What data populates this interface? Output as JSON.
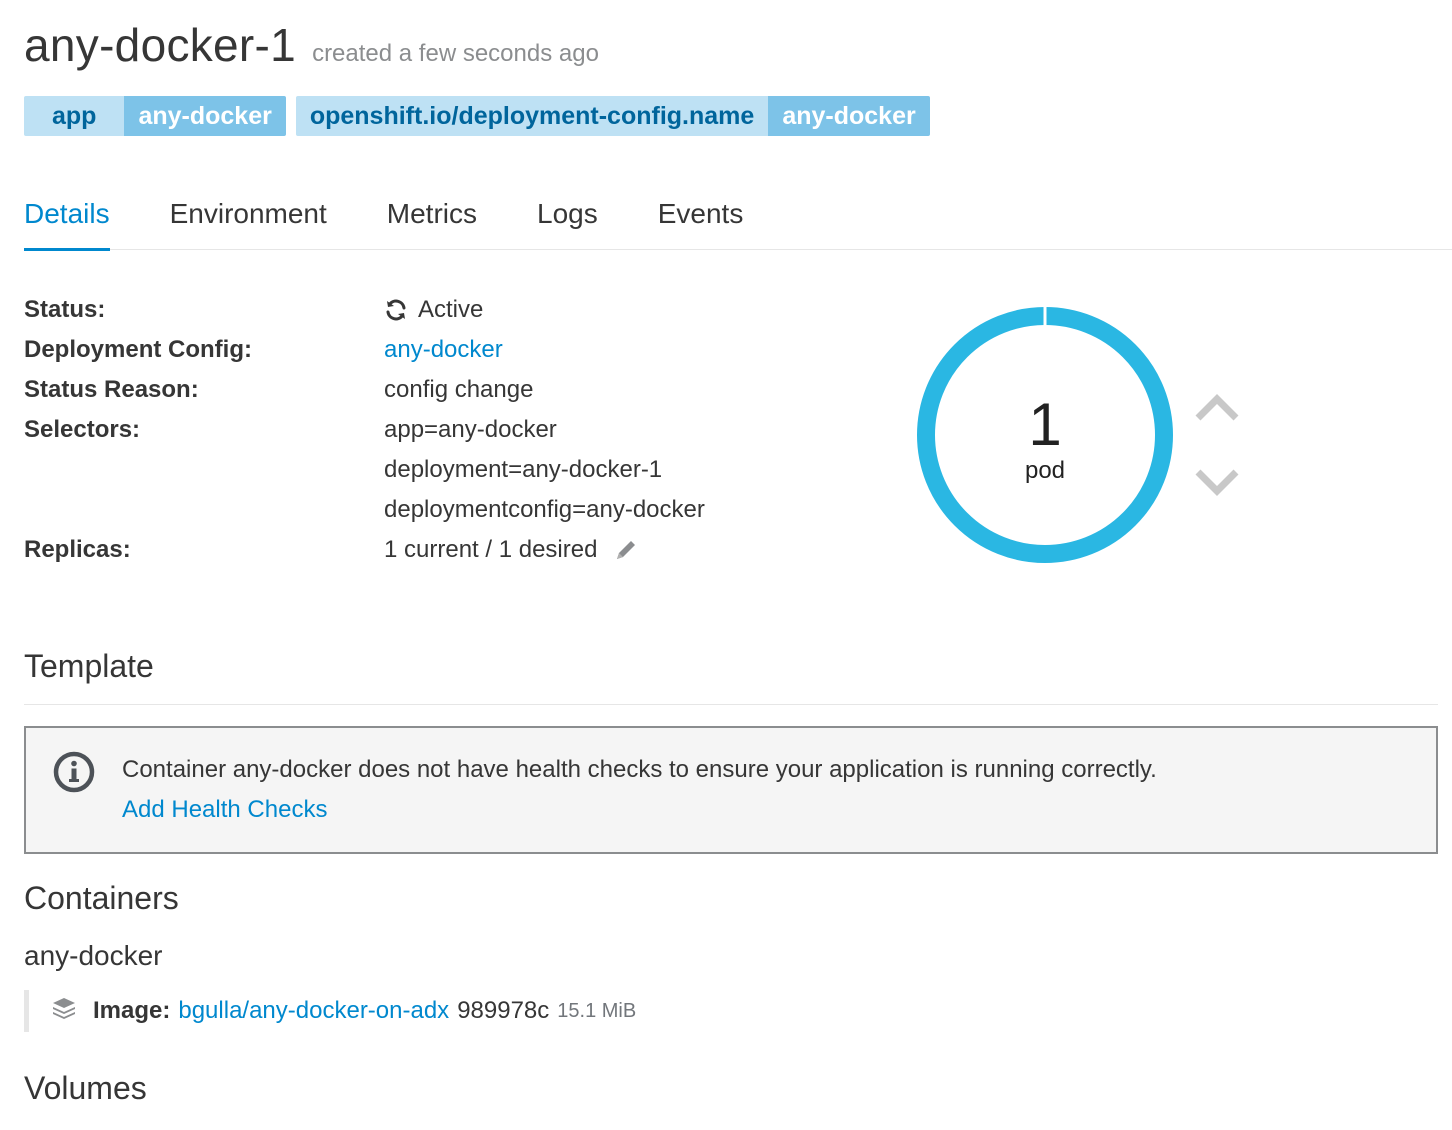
{
  "header": {
    "title": "any-docker-1",
    "created": "created a few seconds ago"
  },
  "labels": [
    {
      "key": "app",
      "value": "any-docker"
    },
    {
      "key": "openshift.io/deployment-config.name",
      "value": "any-docker"
    }
  ],
  "tabs": [
    "Details",
    "Environment",
    "Metrics",
    "Logs",
    "Events"
  ],
  "active_tab": "Details",
  "details": {
    "status_key": "Status:",
    "status_value": "Active",
    "deployment_config_key": "Deployment Config:",
    "deployment_config_value": "any-docker",
    "status_reason_key": "Status Reason:",
    "status_reason_value": "config change",
    "selectors_key": "Selectors:",
    "selectors": [
      "app=any-docker",
      "deployment=any-docker-1",
      "deploymentconfig=any-docker"
    ],
    "replicas_key": "Replicas:",
    "replicas_value": "1 current / 1 desired"
  },
  "donut": {
    "count": "1",
    "unit": "pod",
    "color": "#2ab7e3"
  },
  "template": {
    "title": "Template",
    "alert_text": "Container any-docker does not have health checks to ensure your application is running correctly.",
    "alert_link": "Add Health Checks"
  },
  "containers": {
    "title": "Containers",
    "name": "any-docker",
    "image_label": "Image:",
    "image_link": "bgulla/any-docker-on-adx",
    "image_hash": "989978c",
    "image_size": "15.1 MiB"
  },
  "volumes": {
    "title": "Volumes"
  },
  "colors": {
    "accent": "#0088ce",
    "label_key_bg": "#bee1f4",
    "label_value_bg": "#7dc3e8"
  }
}
